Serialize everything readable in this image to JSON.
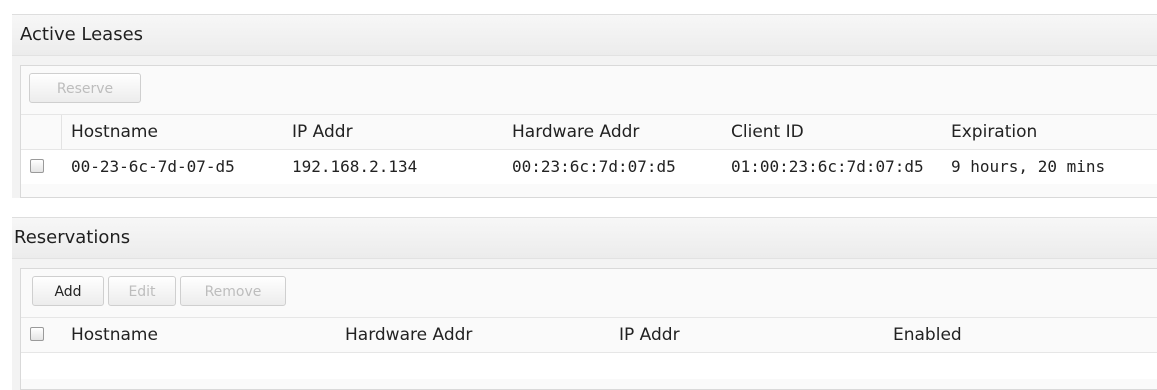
{
  "active_leases": {
    "title": "Active Leases",
    "toolbar": {
      "reserve_label": "Reserve"
    },
    "columns": [
      "Hostname",
      "IP Addr",
      "Hardware Addr",
      "Client ID",
      "Expiration"
    ],
    "rows": [
      {
        "hostname": "00-23-6c-7d-07-d5",
        "ip": "192.168.2.134",
        "hardware": "00:23:6c:7d:07:d5",
        "client_id": "01:00:23:6c:7d:07:d5",
        "expiration": "9 hours, 20 mins",
        "checked": false
      }
    ]
  },
  "reservations": {
    "title": "Reservations",
    "toolbar": {
      "add_label": "Add",
      "edit_label": "Edit",
      "remove_label": "Remove"
    },
    "columns": [
      "Hostname",
      "Hardware Addr",
      "IP Addr",
      "Enabled"
    ],
    "rows": []
  },
  "colors": {
    "panel_bg": "#f3f3f3",
    "disabled_text": "#bdbdbd",
    "border": "#d9d9d9"
  }
}
